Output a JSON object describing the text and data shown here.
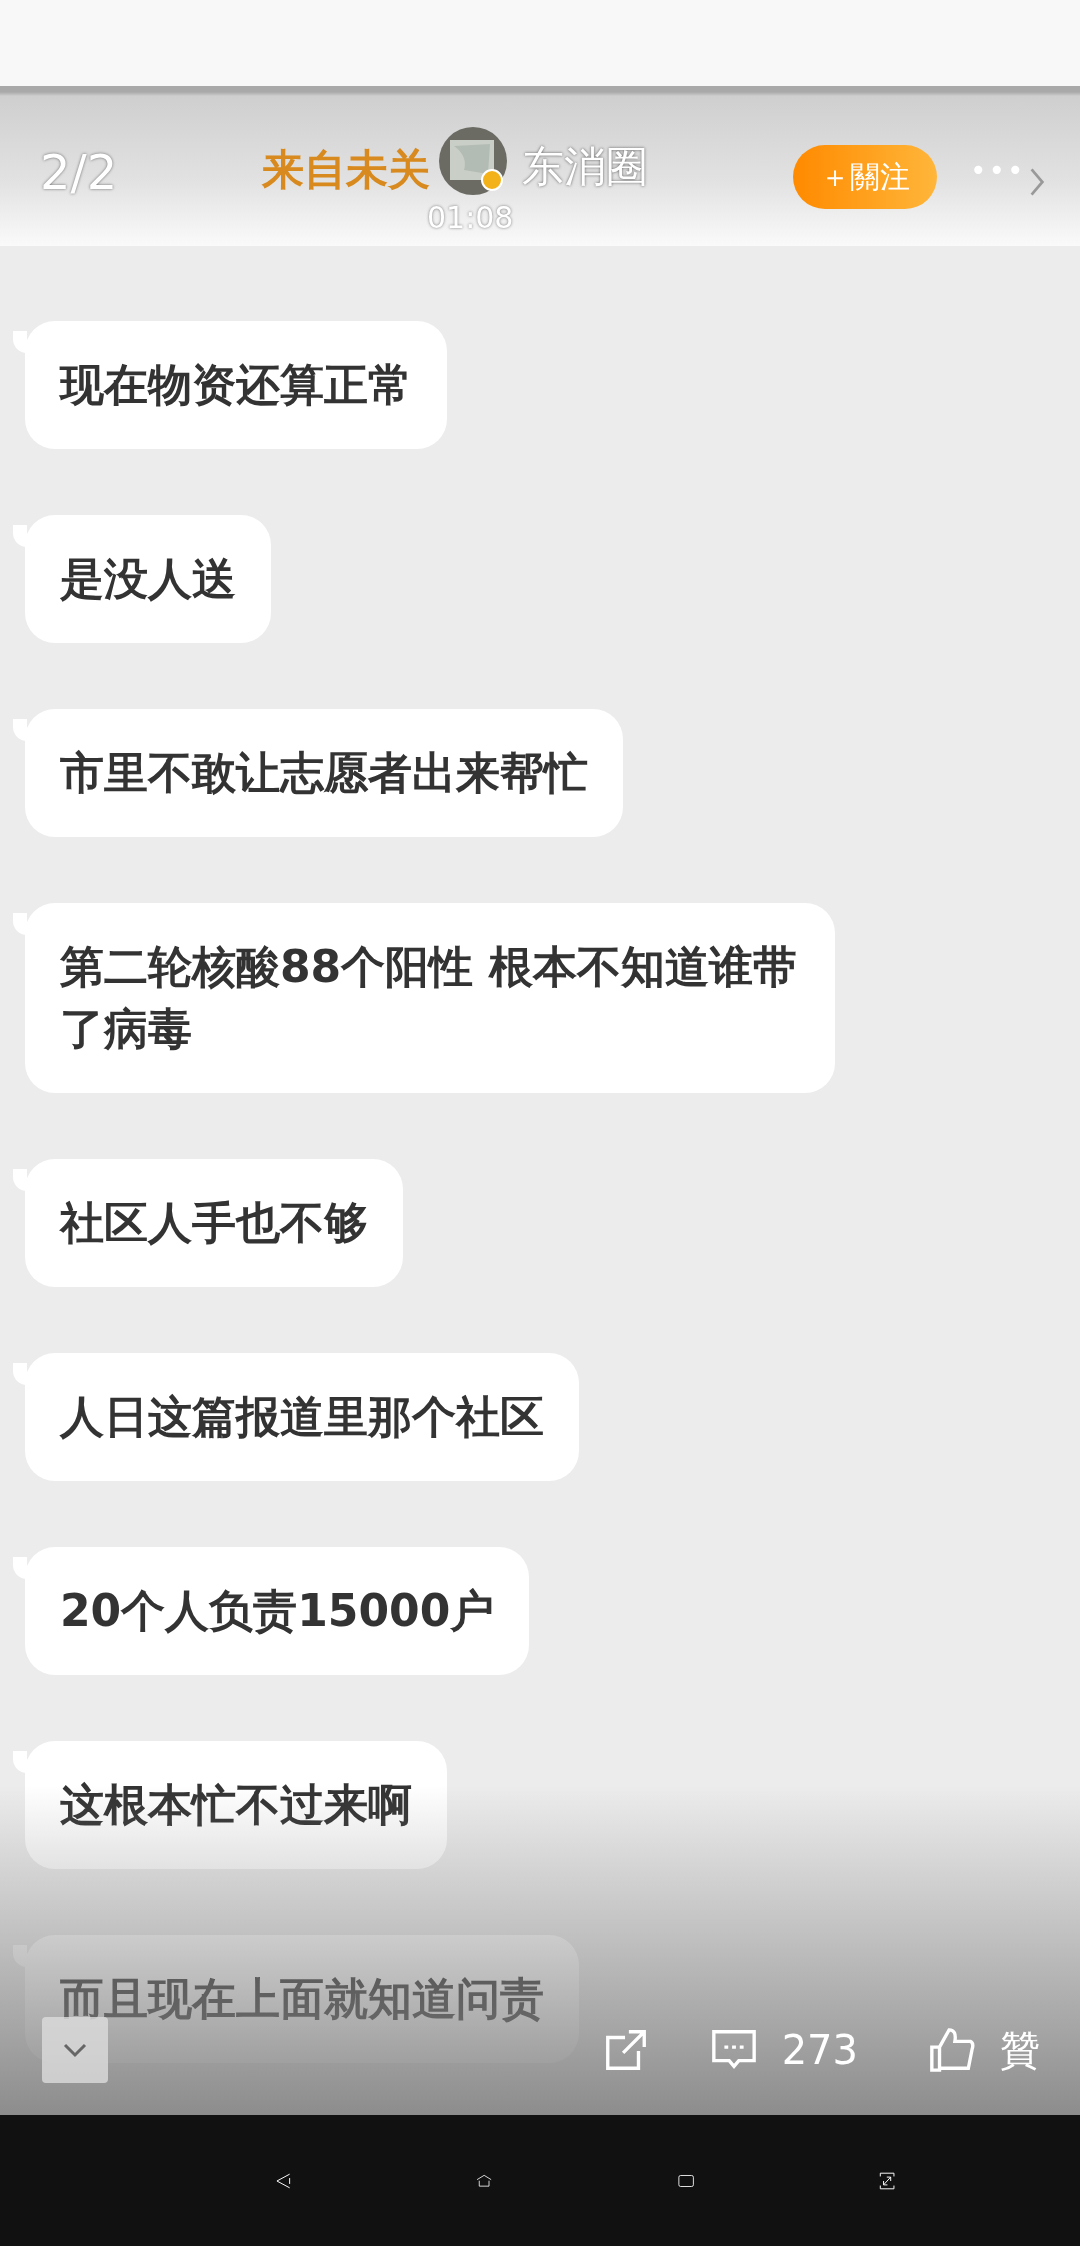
{
  "header": {
    "counter": "2/2",
    "title": "来自未关",
    "author": "东消圈",
    "time": "01:08",
    "follow_button": "＋關注",
    "more": "•••"
  },
  "messages": [
    {
      "text": "现在物资还算正常"
    },
    {
      "text": "是没人送"
    },
    {
      "text": "市里不敢让志愿者出来帮忙"
    },
    {
      "text": "第二轮核酸88个阳性 根本不知道谁带了病毒"
    },
    {
      "text": "社区人手也不够"
    },
    {
      "text": "人日这篇报道里那个社区"
    },
    {
      "text": "20个人负责15000户"
    },
    {
      "text": "这根本忙不过来啊"
    },
    {
      "text": "而且现在上面就知道问责"
    }
  ],
  "actions": {
    "comments": "273",
    "like": "贊"
  }
}
